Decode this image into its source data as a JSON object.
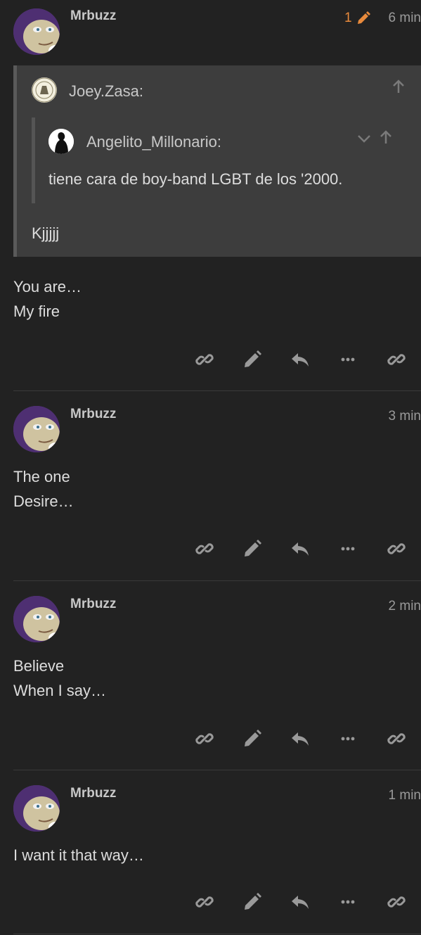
{
  "posts": [
    {
      "username": "Mrbuzz",
      "edit_count": "1",
      "time": "6 min",
      "quote": {
        "author": "Joey.Zasa:",
        "nested": {
          "author": "Angelito_Millonario:",
          "text": "tiene cara de boy-band LGBT de los '2000."
        },
        "text": "Kjjjjj"
      },
      "lines": [
        "You are…",
        "My fire"
      ]
    },
    {
      "username": "Mrbuzz",
      "time": "3 min",
      "lines": [
        "The one",
        "Desire…"
      ]
    },
    {
      "username": "Mrbuzz",
      "time": "2 min",
      "lines": [
        "Believe",
        "When I say…"
      ]
    },
    {
      "username": "Mrbuzz",
      "time": "1 min",
      "lines": [
        "I want it that way…"
      ]
    }
  ],
  "actions": [
    "link-icon",
    "pencil-icon",
    "reply-icon",
    "more-icon",
    "link-icon"
  ],
  "colors": {
    "background": "#222222",
    "quote_background": "#3d3d3d",
    "edit_accent": "#e88a3c",
    "icon": "#9a9a9a"
  }
}
